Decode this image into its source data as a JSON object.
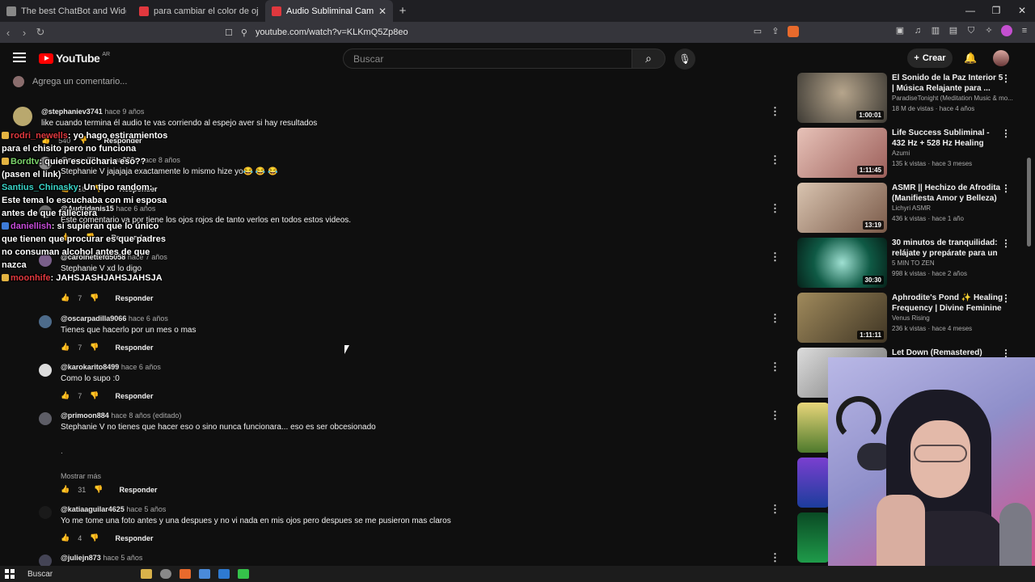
{
  "browser": {
    "tabs": [
      {
        "label": "The best ChatBot and Widgets for Ki",
        "icon": "tab-favicon-icon"
      },
      {
        "label": "para cambiar el color de ojos sublim",
        "icon": "youtube-favicon-icon"
      },
      {
        "label": "Audio Subliminal Cambiar Color",
        "icon": "youtube-favicon-icon",
        "active": true
      }
    ],
    "url": "youtube.com/watch?v=KLKmQ5Zp8eo"
  },
  "header": {
    "logo": "YouTube",
    "country": "AR",
    "search_placeholder": "Buscar",
    "create_label": "Crear"
  },
  "comments": {
    "add_placeholder": "Agrega un comentario...",
    "items": [
      {
        "user": "@stephaniev3741",
        "time": "hace 9 años",
        "text": "like cuando termina él audio te vas corriendo al espejo aver si hay resultados",
        "likes": "540",
        "reply": "Responder"
      },
      {
        "user": "@noemililiaspena8966",
        "time": "hace 8 años",
        "text": "Stephanie V jajajaja exactamente lo mismo hize yo😂 😂 😂",
        "likes": "18",
        "reply": "Responder"
      },
      {
        "user": "@Audridanis15",
        "time": "hace 6 años",
        "text": "Este comentario va por tiene los ojos rojos de tanto verlos en todos estos videos.",
        "likes": "",
        "reply": "Responder"
      },
      {
        "user": "@carolnettefd5058",
        "time": "hace 7 años",
        "text": "Stephanie V xd lo digo",
        "likes": "7",
        "reply": "Responder"
      },
      {
        "user": "@oscarpadilla9066",
        "time": "hace 6 años",
        "text": "Tienes que hacerlo por un mes o mas",
        "likes": "7",
        "reply": "Responder"
      },
      {
        "user": "@karokarito8499",
        "time": "hace 6 años",
        "text": "Como lo supo :0",
        "likes": "7",
        "reply": "Responder"
      },
      {
        "user": "@primoon884",
        "time": "hace 8 años (editado)",
        "text": "Stephanie V no tienes que hacer eso o sino nunca funcionara... eso es ser obcesionado",
        "likes": "31",
        "reply": "Responder"
      },
      {
        "user": "@katiaaguilar4625",
        "time": "hace 5 años",
        "text": "Yo me tome una foto antes y una despues y no vi nada en mis ojos pero despues se me pusieron mas claros",
        "likes": "4",
        "reply": "Responder"
      },
      {
        "user": "@juliejn873",
        "time": "hace 5 años",
        "text": "",
        "likes": "",
        "reply": ""
      }
    ],
    "show_more": "Mostrar más",
    "dot_char": "."
  },
  "chat": [
    {
      "user": "rodri_newells",
      "user_color": "#e0383e",
      "text": ": yo hago estiramientos para el chisito pero no funciona"
    },
    {
      "user": "Bordtv",
      "user_color": "#7bd36a",
      "text": ": quien escucharia eso?? (pasen el link)"
    },
    {
      "user": "Santius_Chinasky",
      "user_color": "#39d3c6",
      "text": ": Un tipo random: Este tema lo escuchaba con mi esposa antes de que falleciera"
    },
    {
      "user": "daniellish",
      "user_color": "#c64bd8",
      "text": ": si supieran que lo único que tienen que procurar es que padres no consuman alcohol antes de que nazca"
    },
    {
      "user": "moonhife",
      "user_color": "#e0383e",
      "text": ": JAHSJASHJAHSJAHSJA"
    }
  ],
  "sidebar": {
    "videos": [
      {
        "title": "El Sonido de la Paz Interior 5 | Música Relajante para ...",
        "channel": "ParadiseTonight (Meditation Music & mo...",
        "meta": "18 M de vistas · hace 4 años",
        "duration": "1:00:01",
        "color": "#8a7f6f"
      },
      {
        "title": "Life Success Subliminal - 432 Hz + 528 Hz Healing Frequenc...",
        "channel": "Azumi",
        "meta": "135 k vistas · hace 3 meses",
        "duration": "1:11:45",
        "color": "#c99590"
      },
      {
        "title": "ASMR || Hechizo de Afrodita (Manifiesta Amor y Belleza) -...",
        "channel": "Lichyri ASMR",
        "meta": "436 k vistas · hace 1 año",
        "duration": "13:19",
        "color": "#b89682"
      },
      {
        "title": "30 minutos de tranquilidad: relájate y prepárate para un ...",
        "channel": "5 MIN TO ZEN",
        "meta": "998 k vistas · hace 2 años",
        "duration": "30:30",
        "color": "#1f6b55"
      },
      {
        "title": "Aphrodite's Pond ✨ Healing Frequency | Divine Feminine ...",
        "channel": "Venus Rising",
        "meta": "236 k vistas · hace 4 meses",
        "duration": "1:11:11",
        "color": "#6e5d3f"
      },
      {
        "title": "Let Down (Remastered)",
        "channel": "",
        "meta": "",
        "duration": "",
        "color": "#c9c9c9"
      }
    ]
  },
  "taskbar": {
    "search_label": "Buscar"
  }
}
